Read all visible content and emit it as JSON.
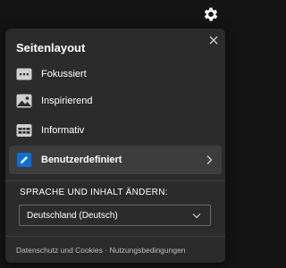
{
  "panel": {
    "title": "Seitenlayout",
    "layouts": [
      {
        "label": "Fokussiert",
        "icon": "focused-layout-icon",
        "selected": false
      },
      {
        "label": "Inspirierend",
        "icon": "image-layout-icon",
        "selected": false
      },
      {
        "label": "Informativ",
        "icon": "informational-layout-icon",
        "selected": false
      },
      {
        "label": "Benutzerdefiniert",
        "icon": "pencil-icon",
        "selected": true
      }
    ],
    "language_section": {
      "heading": "SPRACHE UND INHALT ÄNDERN:",
      "selected_value": "Deutschland (Deutsch)"
    },
    "footer": {
      "privacy_link": "Datenschutz und Cookies",
      "separator": "·",
      "terms_link": "Nutzungsbedingungen"
    }
  },
  "colors": {
    "background": "#141414",
    "panel": "#2b2b2b",
    "selected_row": "#3d3d3d",
    "accent_blue": "#0a6fd6"
  }
}
